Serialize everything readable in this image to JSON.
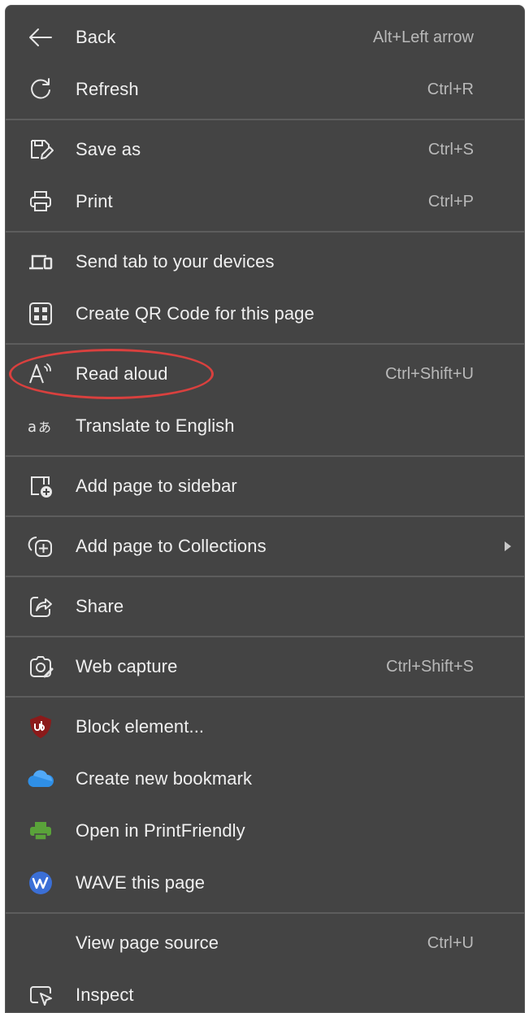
{
  "menu": {
    "items": [
      {
        "label": "Back",
        "shortcut": "Alt+Left arrow",
        "icon": "arrow-left-icon"
      },
      {
        "label": "Refresh",
        "shortcut": "Ctrl+R",
        "icon": "refresh-icon"
      },
      {
        "label": "Save as",
        "shortcut": "Ctrl+S",
        "icon": "save-as-icon"
      },
      {
        "label": "Print",
        "shortcut": "Ctrl+P",
        "icon": "printer-icon"
      },
      {
        "label": "Send tab to your devices",
        "shortcut": "",
        "icon": "devices-icon"
      },
      {
        "label": "Create QR Code for this page",
        "shortcut": "",
        "icon": "qr-code-icon"
      },
      {
        "label": "Read aloud",
        "shortcut": "Ctrl+Shift+U",
        "icon": "read-aloud-icon"
      },
      {
        "label": "Translate to English",
        "shortcut": "",
        "icon": "translate-icon"
      },
      {
        "label": "Add page to sidebar",
        "shortcut": "",
        "icon": "sidebar-add-icon"
      },
      {
        "label": "Add page to Collections",
        "shortcut": "",
        "icon": "collections-icon"
      },
      {
        "label": "Share",
        "shortcut": "",
        "icon": "share-icon"
      },
      {
        "label": "Web capture",
        "shortcut": "Ctrl+Shift+S",
        "icon": "web-capture-icon"
      },
      {
        "label": "Block element...",
        "shortcut": "",
        "icon": "ublock-icon"
      },
      {
        "label": "Create new bookmark",
        "shortcut": "",
        "icon": "cloud-bookmark-icon"
      },
      {
        "label": "Open in PrintFriendly",
        "shortcut": "",
        "icon": "printfriendly-icon"
      },
      {
        "label": "WAVE this page",
        "shortcut": "",
        "icon": "wave-icon"
      },
      {
        "label": "View page source",
        "shortcut": "Ctrl+U",
        "icon": ""
      },
      {
        "label": "Inspect",
        "shortcut": "",
        "icon": "inspect-icon"
      }
    ]
  },
  "colors": {
    "menu_background": "#444444",
    "highlight_ring": "#d9403e",
    "ublock_red": "#8b1a1a",
    "cloud_blue": "#2f8fe6",
    "printfriendly_green": "#5aa33a",
    "wave_blue": "#3b6fd6"
  }
}
